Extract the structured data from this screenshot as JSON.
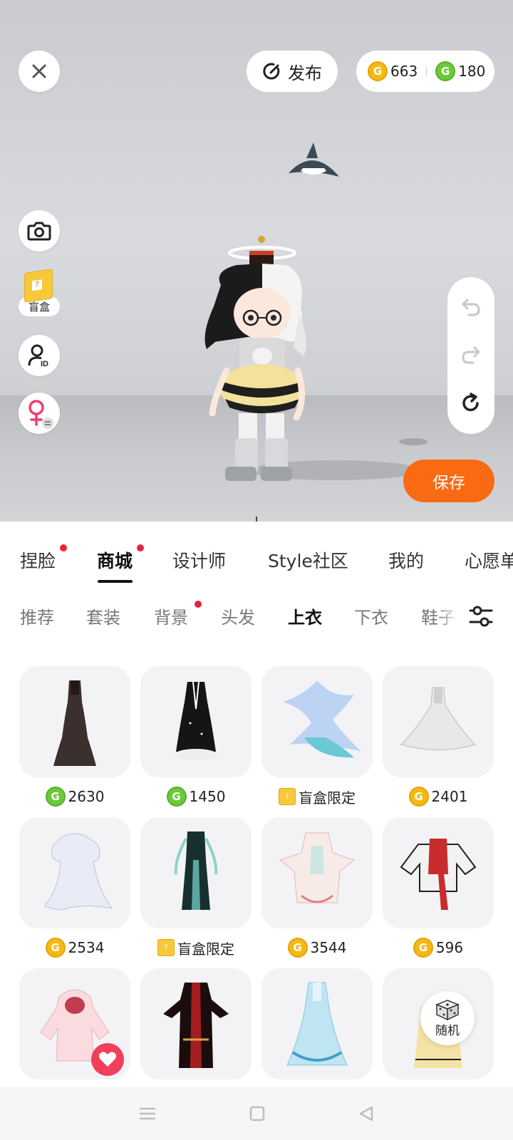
{
  "header": {
    "publish_label": "发布",
    "gold_balance": "663",
    "green_balance": "180"
  },
  "left_tools": {
    "blindbox_label": "盲盒"
  },
  "save_label": "保存",
  "main_tabs": [
    {
      "label": "捏脸",
      "dot": true
    },
    {
      "label": "商城",
      "dot": true,
      "active": true
    },
    {
      "label": "设计师"
    },
    {
      "label": "Style社区"
    },
    {
      "label": "我的"
    },
    {
      "label": "心愿单"
    }
  ],
  "sub_tabs": [
    {
      "label": "推荐"
    },
    {
      "label": "套装"
    },
    {
      "label": "背景",
      "dot": true
    },
    {
      "label": "头发"
    },
    {
      "label": "上衣",
      "active": true
    },
    {
      "label": "下衣"
    },
    {
      "label": "鞋子"
    }
  ],
  "items": [
    {
      "currency": "green",
      "price": "2630"
    },
    {
      "currency": "green",
      "price": "1450"
    },
    {
      "currency": "blindbox",
      "price": "盲盒限定"
    },
    {
      "currency": "gold",
      "price": "2401"
    },
    {
      "currency": "gold",
      "price": "2534"
    },
    {
      "currency": "blindbox",
      "price": "盲盒限定"
    },
    {
      "currency": "gold",
      "price": "3544"
    },
    {
      "currency": "gold",
      "price": "596"
    },
    {
      "currency": "",
      "price": ""
    },
    {
      "currency": "",
      "price": ""
    },
    {
      "currency": "",
      "price": ""
    },
    {
      "currency": "",
      "price": ""
    }
  ],
  "random_label": "随机",
  "colors": {
    "accent_orange": "#fa6a12",
    "badge_red": "#e8233b",
    "gold_coin": "#f4b915",
    "green_coin": "#6cc93a",
    "heart": "#f0405a"
  }
}
